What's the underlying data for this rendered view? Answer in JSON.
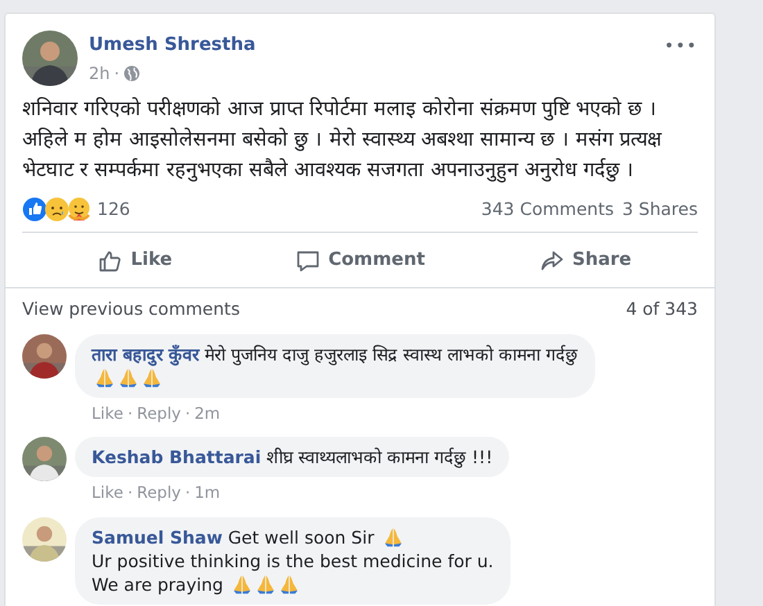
{
  "post": {
    "author": "Umesh Shrestha",
    "time": "2h",
    "separator": "·",
    "more": "•••",
    "text": "शनिवार गरिएको परीक्षणको आज प्राप्त रिपोर्टमा मलाइ कोरोना संक्रमण पुष्टि भएको छ । अहिले म होम आइसोलेसनमा बसेको छु । मेरो स्वास्थ्य अबश्था सामान्य छ । मसंग प्रत्यक्ष भेटघाट र सम्पर्कमा रहनुभएका सबैले आवश्यक सजगता अपनाउनुहुन अनुरोध गर्दछु ।",
    "reaction_count": "126",
    "comments_count": "343 Comments",
    "shares_count": "3 Shares"
  },
  "actions": [
    {
      "kind": "like",
      "label": "Like"
    },
    {
      "kind": "comment",
      "label": "Comment"
    },
    {
      "kind": "share",
      "label": "Share"
    }
  ],
  "view_previous": "View previous comments",
  "comment_position": "4 of 343",
  "comments": [
    {
      "author": "तारा बहादुर कुँवर",
      "parts": [
        {
          "kind": "text",
          "text": "मेरो पुजनिय दाजु हजुरलाइ सिद्र स्वास्थ लाभको कामना गर्दछु"
        },
        {
          "kind": "break"
        },
        {
          "kind": "icon"
        },
        {
          "kind": "icon"
        },
        {
          "kind": "icon"
        }
      ],
      "like": "Like",
      "separator_1": "·",
      "reply": "Reply",
      "separator_2": "·",
      "time": "2m"
    },
    {
      "author": "Keshab Bhattarai",
      "parts": [
        {
          "kind": "text",
          "text": "शीघ्र स्वाथ्यलाभको कामना गर्दछु !!!"
        }
      ],
      "like": "Like",
      "separator_1": "·",
      "reply": "Reply",
      "separator_2": "·",
      "time": "1m"
    },
    {
      "author": "Samuel Shaw",
      "parts": [
        {
          "kind": "text",
          "text": "Get well soon Sir"
        },
        {
          "kind": "icon"
        },
        {
          "kind": "break"
        },
        {
          "kind": "text",
          "text": "Ur positive thinking is the best medicine for u."
        },
        {
          "kind": "break"
        },
        {
          "kind": "text",
          "text": "We are praying"
        },
        {
          "kind": "icon"
        },
        {
          "kind": "icon"
        },
        {
          "kind": "icon"
        }
      ]
    }
  ]
}
